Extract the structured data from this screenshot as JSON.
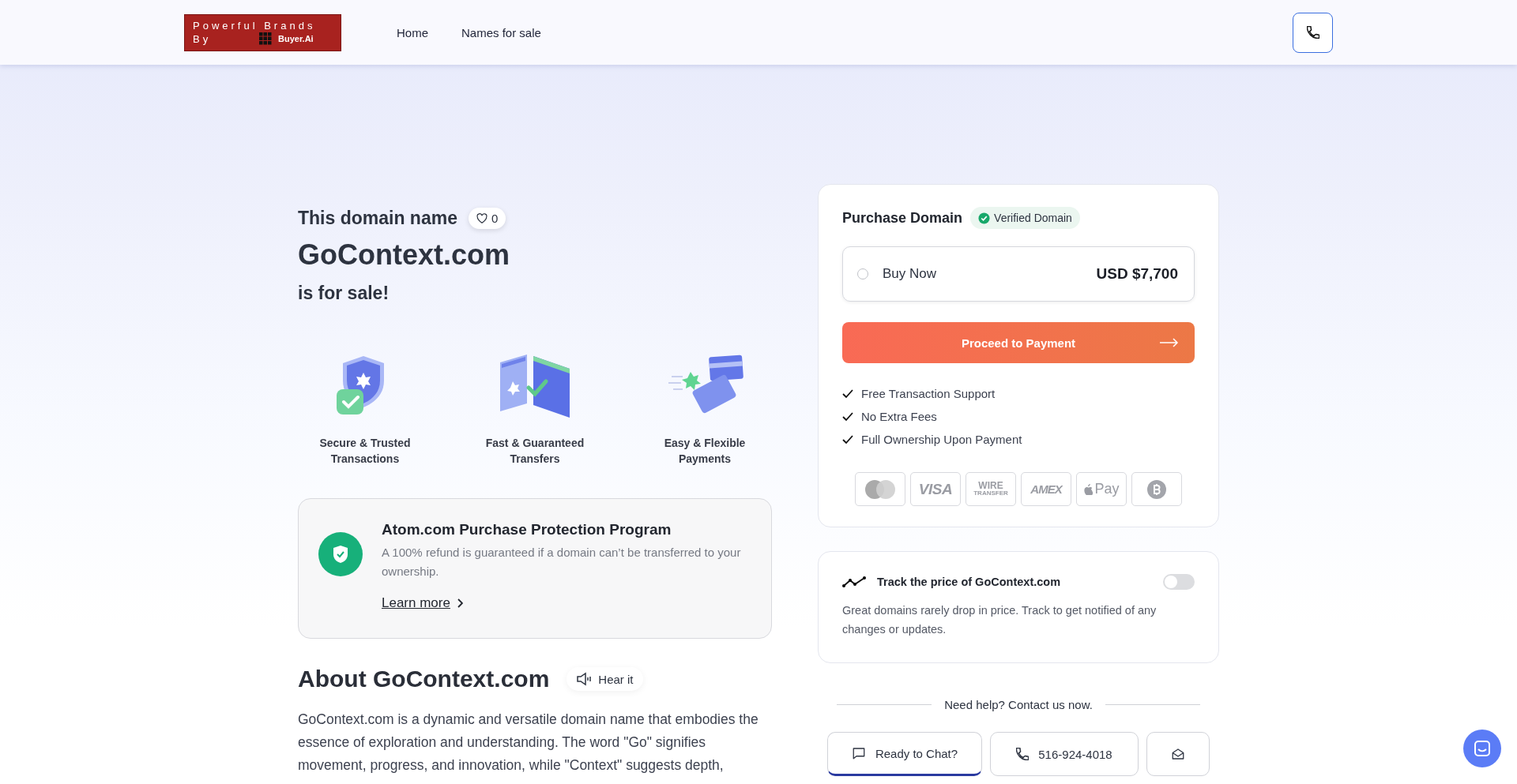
{
  "header": {
    "logo": {
      "line1": "Powerful Brands",
      "line2": "By",
      "brand": "Buyer.Ai"
    },
    "nav": [
      {
        "label": "Home"
      },
      {
        "label": "Names for sale"
      }
    ]
  },
  "hero": {
    "intro": "This domain name",
    "likes": "0",
    "domain": "GoContext.com",
    "tagline": "is for sale!"
  },
  "features": [
    {
      "kind": "shield",
      "label": "Secure & Trusted Transactions"
    },
    {
      "kind": "transfer",
      "label": "Fast & Guaranteed Transfers"
    },
    {
      "kind": "cards",
      "label": "Easy & Flexible Payments"
    }
  ],
  "protection": {
    "title": "Atom.com Purchase Protection Program",
    "text": "A 100% refund is guaranteed if a domain can’t be transferred to your ownership.",
    "link": "Learn more"
  },
  "about": {
    "title": "About GoContext.com",
    "hear": "Hear it",
    "paragraph": "GoContext.com is a dynamic and versatile domain name that embodies the essence of exploration and understanding. The word \"Go\" signifies movement, progress, and innovation, while \"Context\" suggests depth,"
  },
  "purchase": {
    "title": "Purchase Domain",
    "badge": "Verified Domain",
    "option": {
      "label": "Buy Now",
      "price": "USD $7,700",
      "selected": false
    },
    "button": "Proceed to Payment",
    "perks": [
      "Free Transaction Support",
      "No Extra Fees",
      "Full Ownership Upon Payment"
    ],
    "payment_methods": [
      {
        "kind": "mastercard"
      },
      {
        "kind": "visa",
        "label": "VISA"
      },
      {
        "kind": "wire",
        "label": "WIRE",
        "sublabel": "TRANSFER"
      },
      {
        "kind": "amex",
        "label": "AMEX"
      },
      {
        "kind": "applepay",
        "label": "Pay"
      },
      {
        "kind": "bitcoin"
      }
    ]
  },
  "track": {
    "title": "Track the price of GoContext.com",
    "text": "Great domains rarely drop in price. Track to get notified of any changes or updates.",
    "on": false
  },
  "help": {
    "title": "Need help? Contact us now.",
    "buttons": [
      {
        "kind": "chat",
        "label": "Ready to Chat?"
      },
      {
        "kind": "phone",
        "label": "516-924-4018"
      },
      {
        "kind": "email"
      }
    ]
  }
}
